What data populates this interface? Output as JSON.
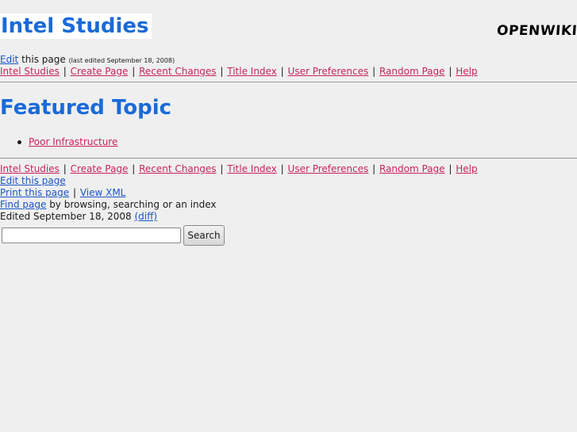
{
  "header": {
    "site_title": "Intel Studies",
    "logo_text": "OPENWIKI"
  },
  "edit_line": {
    "edit_link": "Edit",
    "this_page": " this page ",
    "last_edited": "(last edited September 18, 2008)"
  },
  "nav": {
    "items": [
      "Intel Studies",
      "Create Page",
      "Recent Changes",
      "Title Index",
      "User Preferences",
      "Random Page",
      "Help"
    ],
    "separator": "|"
  },
  "main": {
    "heading": "Featured Topic",
    "topics": [
      "Poor Infrastructure"
    ]
  },
  "footer": {
    "edit_this_page": "Edit this page",
    "print_this_page": "Print this page",
    "view_xml": "View XML",
    "find_page": "Find page",
    "find_suffix": " by browsing, searching or an index",
    "edited_text": "Edited September 18, 2008 ",
    "diff_link": "(diff)"
  },
  "search": {
    "value": "",
    "button_label": "Search"
  },
  "colors": {
    "title_blue": "#1a6ad8",
    "link_blue": "#1a55c8",
    "link_pink": "#c8245c",
    "background": "#efefef"
  }
}
